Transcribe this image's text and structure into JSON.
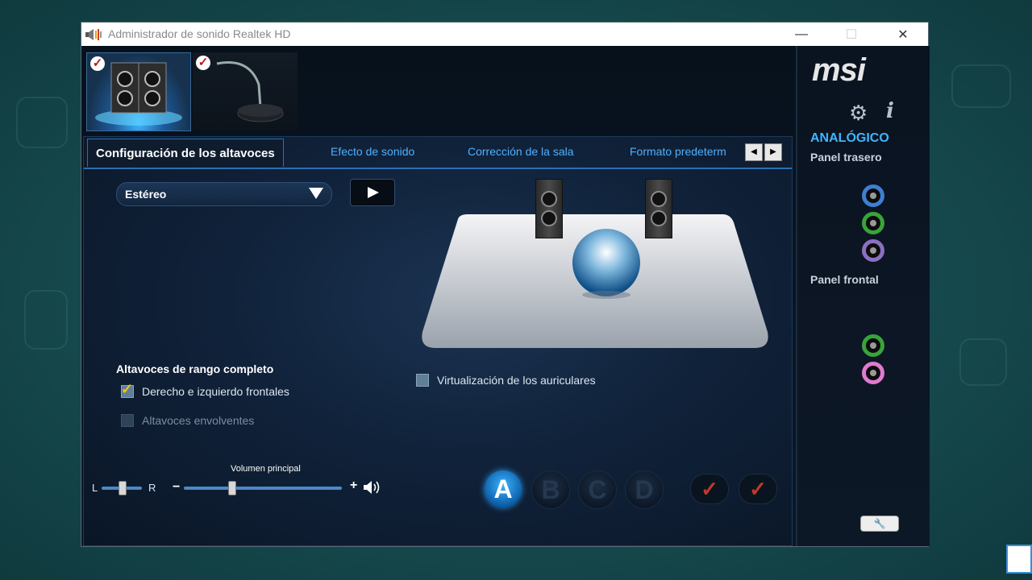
{
  "window": {
    "title": "Administrador de sonido Realtek HD",
    "controls": {
      "minimize": "—",
      "maximize": "☐",
      "close": "✕"
    }
  },
  "devices": [
    {
      "name": "speakers",
      "icon": "speakers-icon",
      "checked": true,
      "selected": true
    },
    {
      "name": "microphone",
      "icon": "microphone-icon",
      "checked": true,
      "selected": false
    }
  ],
  "tabs": {
    "active": "Configuración de los altavoces",
    "others": [
      "Efecto de sonido",
      "Corrección de la sala",
      "Formato predeterm"
    ],
    "prev": "◀",
    "next": "▶"
  },
  "config": {
    "selected": "Estéreo"
  },
  "full_range": {
    "title": "Altavoces de rango completo",
    "front_lr": "Derecho e izquierdo frontales",
    "front_lr_checked": true,
    "surround": "Altavoces envolventes",
    "surround_checked": false
  },
  "virtualization": {
    "label": "Virtualización de los auriculares",
    "checked": false
  },
  "balance": {
    "left": "L",
    "right": "R"
  },
  "volume": {
    "label": "Volumen principal",
    "minus": "−",
    "plus": "+",
    "level": 0.3,
    "balance_level": 0.5
  },
  "profiles": [
    "A",
    "B",
    "C",
    "D"
  ],
  "active_profile": "A",
  "brand": "msi",
  "right_panel": {
    "section": "ANALÓGICO",
    "rear_label": "Panel trasero",
    "front_label": "Panel frontal",
    "rear_jacks": [
      "#3d7fd1",
      "#38a33a",
      "#8a6fc2"
    ],
    "front_jacks": [
      "#38a33a",
      "#e07ad0"
    ]
  },
  "colors": {
    "accent": "#3fb6ff",
    "tab_text": "#4fb0ff",
    "check_red": "#c0392b"
  }
}
